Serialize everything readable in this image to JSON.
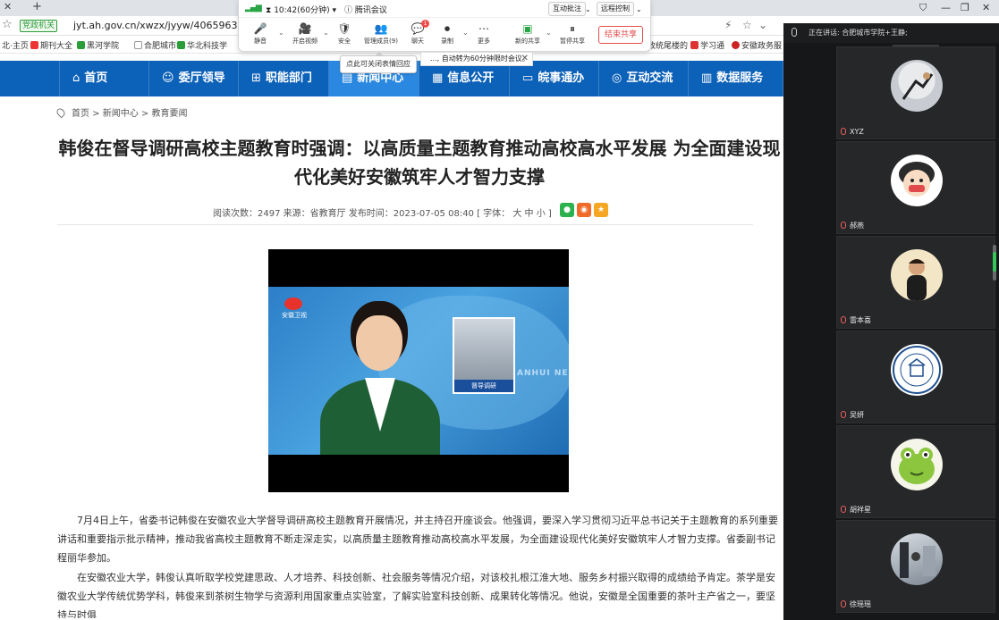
{
  "browser": {
    "tab_close": "✕",
    "tab_new": "+",
    "secure_label": "党政机关",
    "url": "jyt.ah.gov.cn/xwzx/jyyw/40659639.html",
    "bookmarks": [
      "北·主页",
      "期刊大全",
      "黑河学院",
      "合肥城市学",
      "华北科技学",
      "政统尾楼的",
      "学习通",
      "安徽政务服"
    ]
  },
  "meeting": {
    "timer": "10:42(60分钟)",
    "app_name": "腾讯会议",
    "interactive_annotation": "互动批注",
    "remote_control": "远程控制",
    "tools": [
      {
        "label": "静音",
        "icon": "🎤"
      },
      {
        "label": "开启视频",
        "icon": "🎥"
      },
      {
        "label": "安全",
        "icon": "🛡"
      },
      {
        "label": "管理成员(9)",
        "icon": "👥"
      },
      {
        "label": "聊天",
        "icon": "💬",
        "badge": "1"
      },
      {
        "label": "录制",
        "icon": "⏺"
      },
      {
        "label": "更多",
        "icon": "⋯"
      },
      {
        "label": "新的共享",
        "icon": "▣"
      },
      {
        "label": "暂停共享",
        "icon": "⏸"
      }
    ],
    "end_share": "结束共享",
    "tooltip": "点此可关闭表情回应",
    "notice": "..., 自动转为60分钟限时会议。",
    "speaking": "正在讲话: 合肥城市学院+王静;",
    "participants": [
      "XYZ",
      "郝燕",
      "雷本喜",
      "吴妍",
      "胡祥星",
      "徐瑶瑶"
    ]
  },
  "site": {
    "nav": [
      {
        "label": "首页",
        "icon": "⌂"
      },
      {
        "label": "委厅领导",
        "icon": "☺"
      },
      {
        "label": "职能部门",
        "icon": "⊞"
      },
      {
        "label": "新闻中心",
        "icon": "▤"
      },
      {
        "label": "信息公开",
        "icon": "▦"
      },
      {
        "label": "皖事通办",
        "icon": "▭"
      },
      {
        "label": "互动交流",
        "icon": "◎"
      },
      {
        "label": "数据服务",
        "icon": "▥"
      }
    ],
    "breadcrumb": "首页 > 新闻中心 > 教育要闻",
    "title": "韩俊在督导调研高校主题教育时强调：以高质量主题教育推动高校高水平发展 为全面建设现代化美好安徽筑牢人才智力支撑",
    "meta": "阅读次数：2497    来源：省教育厅    发布时间：2023-07-05 08:40    [ 字体： 大  中  小 ]",
    "video": {
      "logo_text": "安徽卫视",
      "inset_caption": "督导调研",
      "watermark": "ANHUI NE"
    },
    "paragraphs": [
      "7月4日上午，省委书记韩俊在安徽农业大学督导调研高校主题教育开展情况，并主持召开座谈会。他强调，要深入学习贯彻习近平总书记关于主题教育的系列重要讲话和重要指示批示精神，推动我省高校主题教育不断走深走实，以高质量主题教育推动高校高水平发展，为全面建设现代化美好安徽筑牢人才智力支撑。省委副书记程丽华参加。",
      "在安徽农业大学，韩俊认真听取学校党建思政、人才培养、科技创新、社会服务等情况介绍，对该校扎根江淮大地、服务乡村振兴取得的成绩给予肯定。茶学是安徽农业大学传统优势学科，韩俊来到茶树生物学与资源利用国家重点实验室，了解实验室科技创新、成果转化等情况。他说，安徽是全国重要的茶叶主产省之一，要坚持与时俱"
    ]
  }
}
